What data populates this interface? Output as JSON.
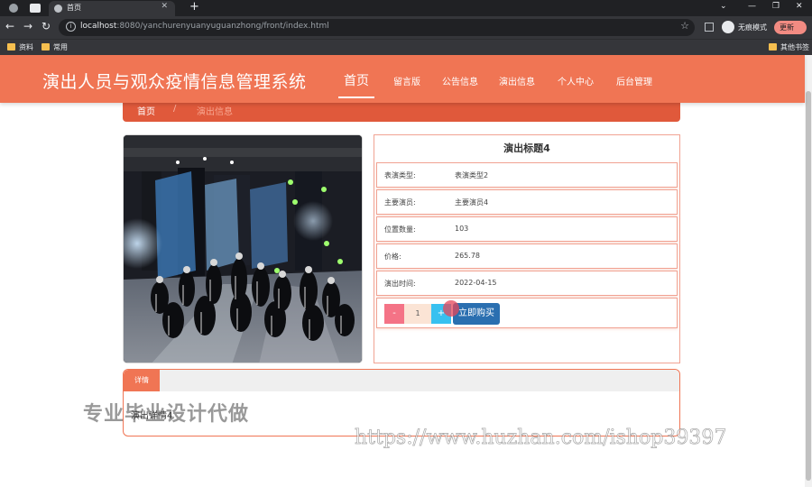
{
  "browser": {
    "tab_title": "首页",
    "url_host": "localhost",
    "url_rest": ":8080/yanchurenyuanyuguanzhong/front/index.html",
    "incognito_label": "无痕模式",
    "update_label": "更新",
    "bookmarks": [
      "资料",
      "常用"
    ],
    "other_bookmarks": "其他书签"
  },
  "site": {
    "title": "演出人员与观众疫情信息管理系统",
    "nav": [
      {
        "label": "首页",
        "active": true
      },
      {
        "label": "留言版"
      },
      {
        "label": "公告信息"
      },
      {
        "label": "演出信息"
      },
      {
        "label": "个人中心"
      },
      {
        "label": "后台管理"
      }
    ],
    "breadcrumb": {
      "home": "首页",
      "sep": "/",
      "current": "演出信息"
    }
  },
  "detail": {
    "title": "演出标题4",
    "fields": [
      {
        "key": "表演类型:",
        "value": "表演类型2"
      },
      {
        "key": "主要演员:",
        "value": "主要演员4"
      },
      {
        "key": "位置数量:",
        "value": "103"
      },
      {
        "key": "价格:",
        "value": "265.78"
      },
      {
        "key": "演出时间:",
        "value": "2022-04-15"
      }
    ],
    "quantity": "1",
    "minus_label": "-",
    "plus_label": "+",
    "buy_label": "立即购买",
    "tab_label": "详情",
    "description": "演出详情4"
  },
  "watermarks": {
    "text1": "专业毕业设计代做",
    "text2": "https://www.huzhan.com/ishop39397"
  },
  "colors": {
    "header": "#f07554",
    "breadcrumb": "#e0593b",
    "buy_button": "#2a6fb0",
    "minus": "#f47386",
    "plus": "#38c1f0"
  }
}
